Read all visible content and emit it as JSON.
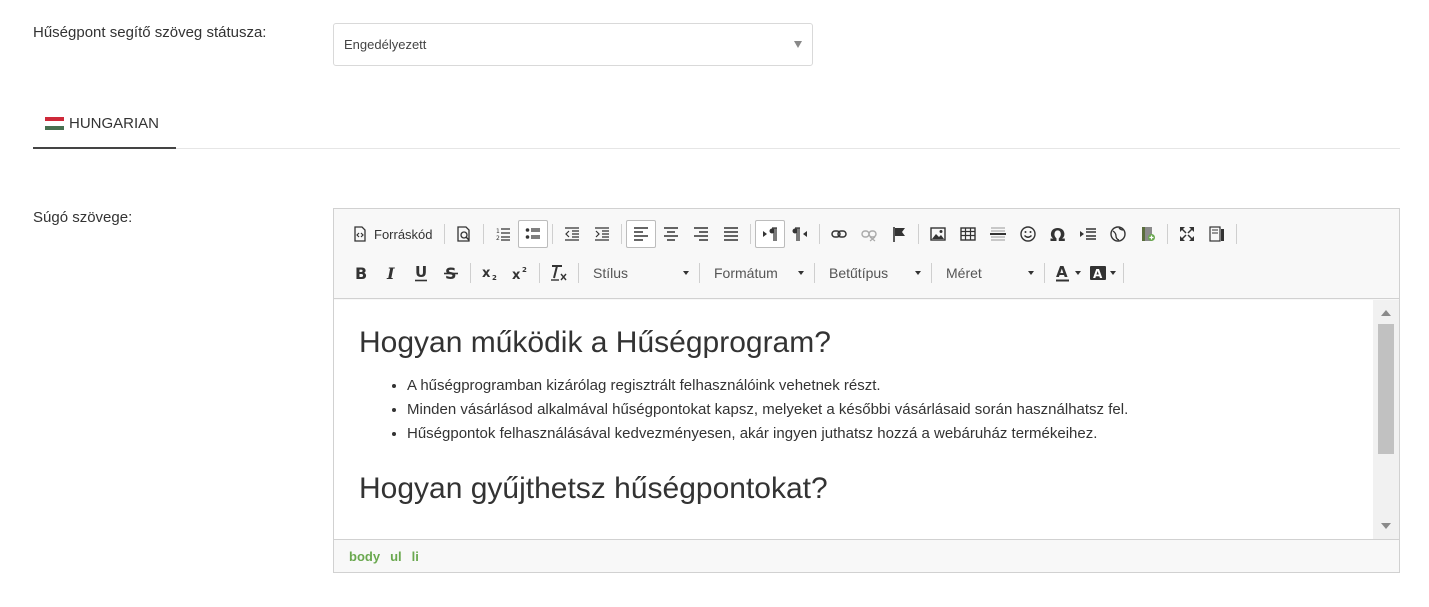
{
  "status": {
    "label": "Hűségpont segítő szöveg státusza:",
    "value": "Engedélyezett"
  },
  "tabs": [
    {
      "label": "HUNGARIAN",
      "flag": "hungary-flag",
      "active": true
    }
  ],
  "help": {
    "label": "Súgó szövege:"
  },
  "toolbar": {
    "source_label": "Forráskód",
    "style_label": "Stílus",
    "format_label": "Formátum",
    "font_label": "Betűtípus",
    "size_label": "Méret"
  },
  "content": {
    "heading1": "Hogyan működik a Hűségprogram?",
    "list1": [
      "A hűségprogramban kizárólag regisztrált felhasználóink vehetnek részt.",
      "Minden vásárlásod alkalmával hűségpontokat kapsz, melyeket a későbbi vásárlásaid során használhatsz fel.",
      "Hűségpontok felhasználásával kedvezményesen, akár ingyen juthatsz hozzá a webáruház termékeihez."
    ],
    "heading2": "Hogyan gyűjthetsz hűségpontokat?"
  },
  "path": [
    "body",
    "ul",
    "li"
  ],
  "colors": {
    "path_green": "#6aa84f",
    "flag_red": "#ce2939",
    "flag_white": "#ffffff",
    "flag_green": "#477050"
  }
}
